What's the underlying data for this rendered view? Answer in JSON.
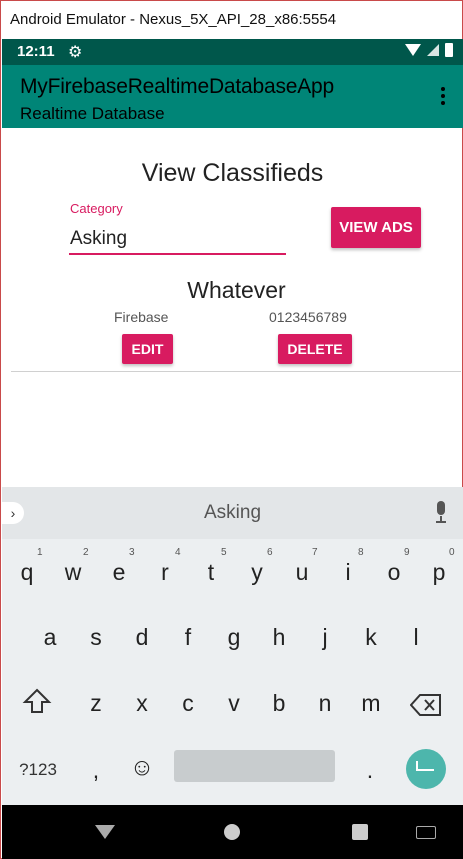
{
  "window": {
    "title": "Android Emulator - Nexus_5X_API_28_x86:5554"
  },
  "status_bar": {
    "time": "12:11"
  },
  "app_bar": {
    "title": "MyFirebaseRealtimeDatabaseApp",
    "subtitle": "Realtime Database"
  },
  "main": {
    "heading": "View Classifieds",
    "category_label": "Category",
    "category_value": "Asking",
    "view_ads_label": "VIEW ADS",
    "item": {
      "title": "Whatever",
      "name": "Firebase",
      "phone": "0123456789",
      "edit_label": "EDIT",
      "delete_label": "DELETE"
    }
  },
  "keyboard": {
    "suggestion": "Asking",
    "row1": [
      {
        "k": "q",
        "n": "1"
      },
      {
        "k": "w",
        "n": "2"
      },
      {
        "k": "e",
        "n": "3"
      },
      {
        "k": "r",
        "n": "4"
      },
      {
        "k": "t",
        "n": "5"
      },
      {
        "k": "y",
        "n": "6"
      },
      {
        "k": "u",
        "n": "7"
      },
      {
        "k": "i",
        "n": "8"
      },
      {
        "k": "o",
        "n": "9"
      },
      {
        "k": "p",
        "n": "0"
      }
    ],
    "row2": [
      "a",
      "s",
      "d",
      "f",
      "g",
      "h",
      "j",
      "k",
      "l"
    ],
    "row3": [
      "z",
      "x",
      "c",
      "v",
      "b",
      "n",
      "m"
    ],
    "symbols_label": "?123",
    "comma": ",",
    "emoji": "☺",
    "period": "."
  },
  "colors": {
    "accent": "#d81b60",
    "primary": "#008577",
    "primary_dark": "#00574b",
    "enter": "#4db6ac"
  }
}
